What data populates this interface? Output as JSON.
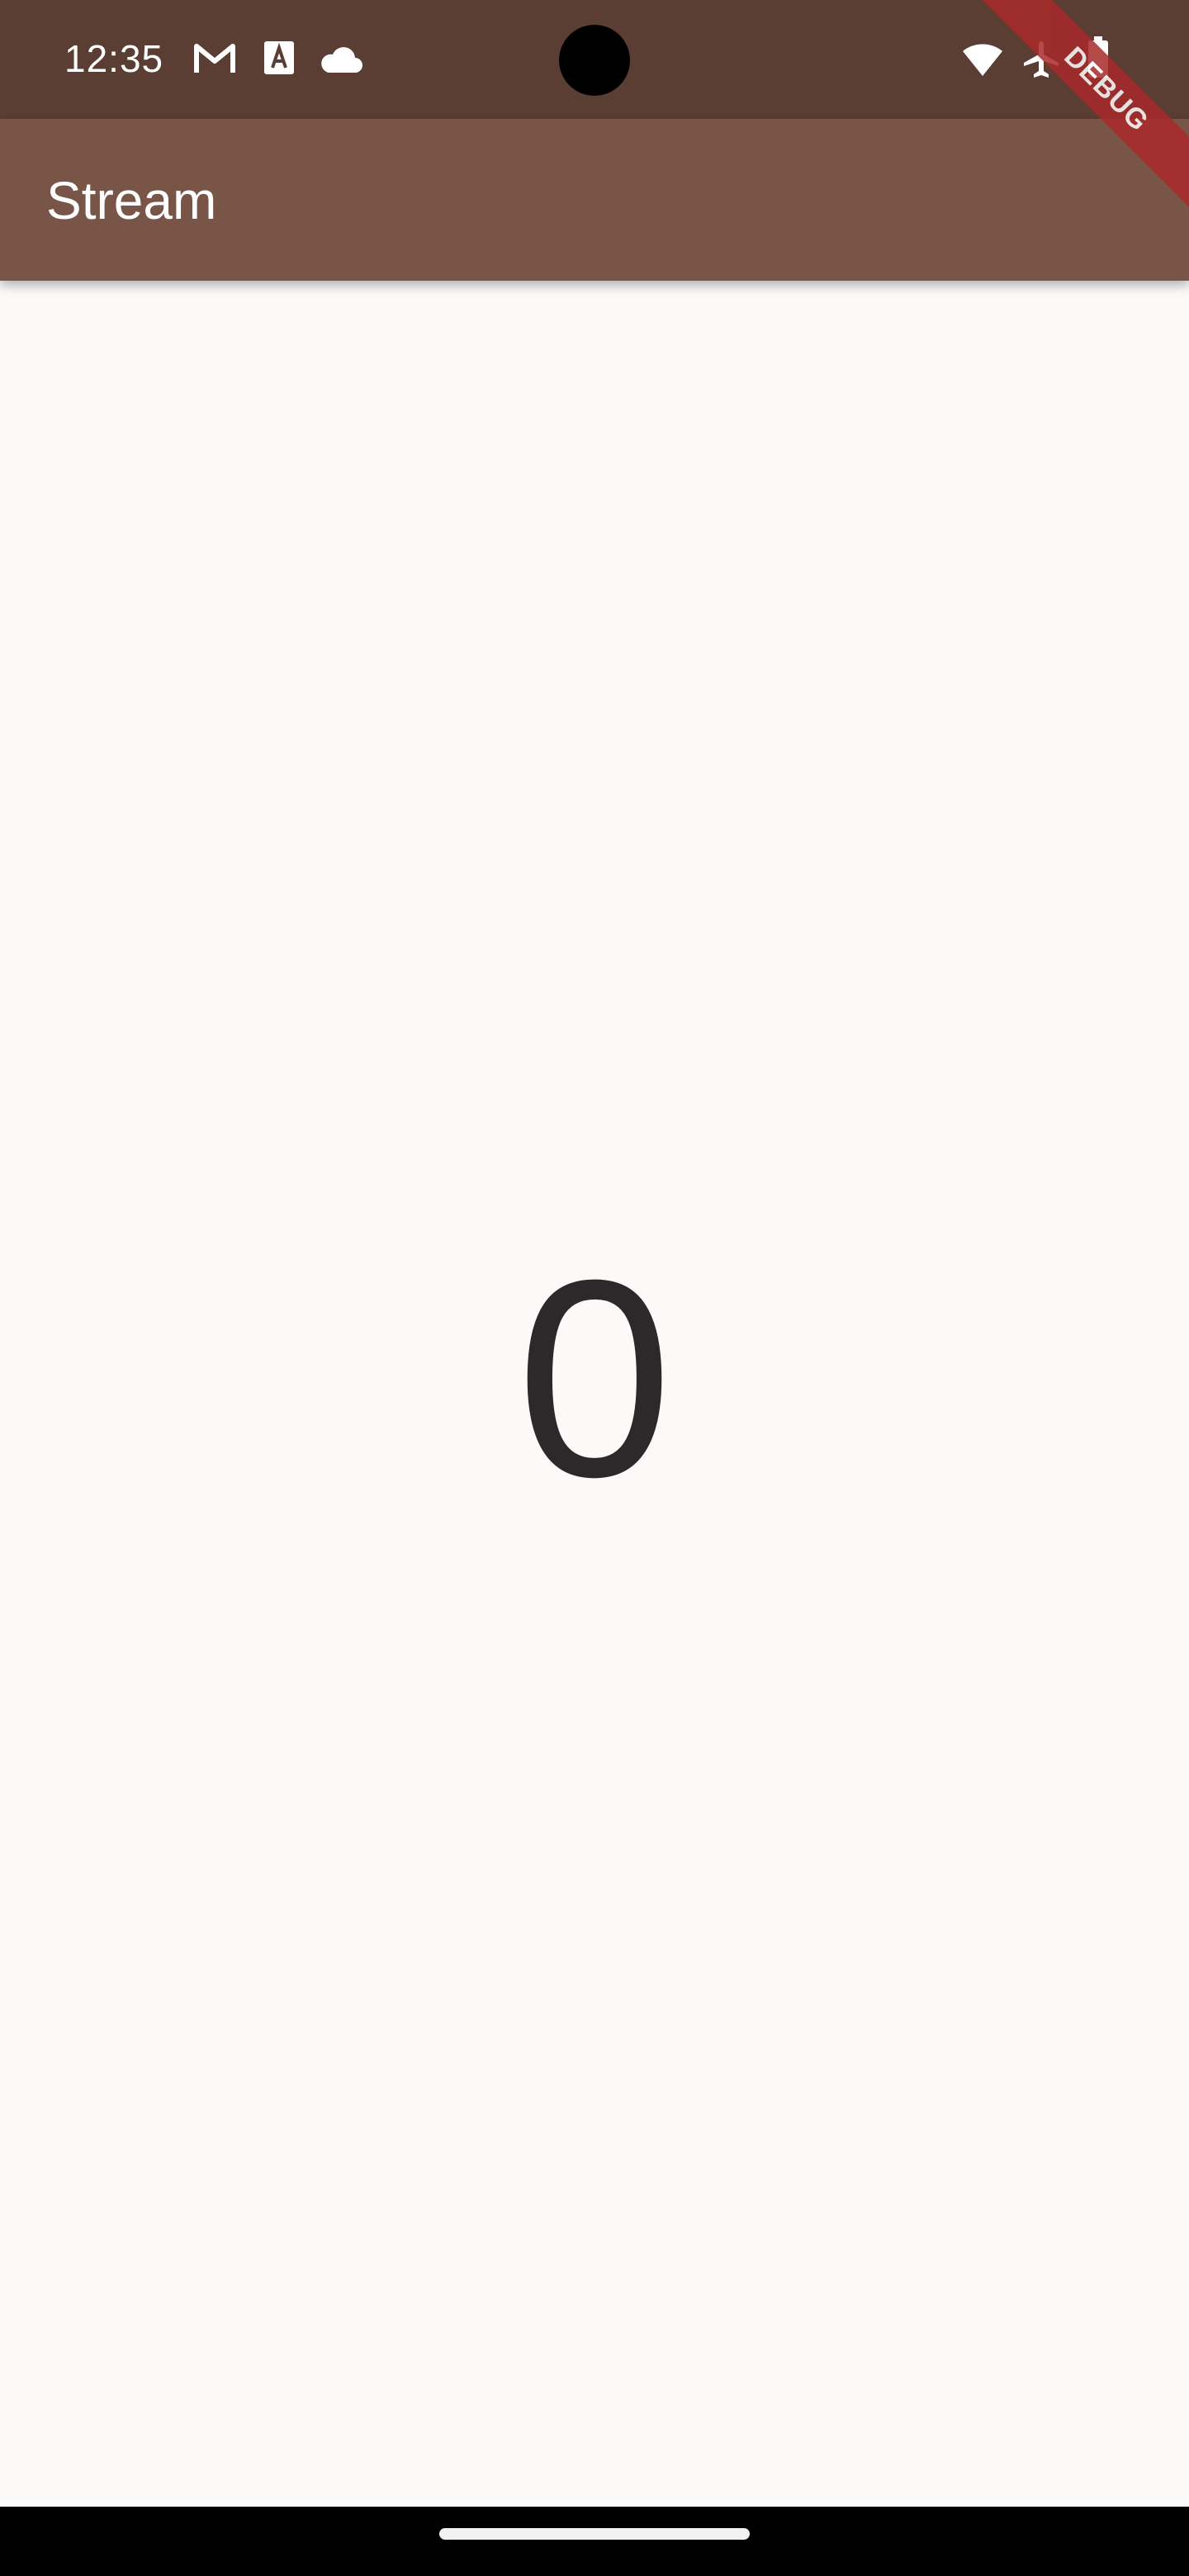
{
  "status_bar": {
    "time": "12:35",
    "left_icons": [
      "gmail-icon",
      "translate-app-icon",
      "cloud-icon"
    ],
    "right_icons": [
      "wifi-icon",
      "airplane-mode-icon",
      "battery-icon"
    ]
  },
  "app_bar": {
    "title": "Stream",
    "color": "#795548"
  },
  "debug_banner": {
    "label": "DEBUG"
  },
  "main": {
    "counter_value": "0"
  }
}
